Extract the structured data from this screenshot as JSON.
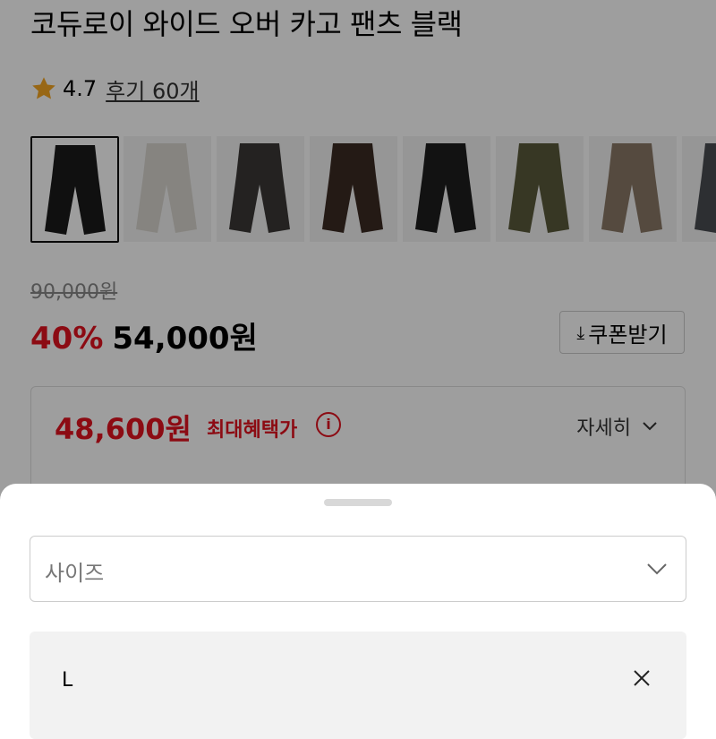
{
  "product": {
    "title": "코듀로이 와이드 오버 카고 팬츠 블랙",
    "rating": "4.7",
    "reviews": "후기 60개",
    "thumbnails": [
      {
        "name": "black",
        "color": "#1b1b1b"
      },
      {
        "name": "ivory",
        "color": "#d9d6cf"
      },
      {
        "name": "charcoal",
        "color": "#3a3836"
      },
      {
        "name": "brown",
        "color": "#3b2a22"
      },
      {
        "name": "black-2",
        "color": "#1e1e1e"
      },
      {
        "name": "khaki",
        "color": "#5a5a3a"
      },
      {
        "name": "beige",
        "color": "#8a7866"
      },
      {
        "name": "gray",
        "color": "#4a4d52"
      }
    ]
  },
  "price": {
    "original": "90,000원",
    "discount": "40%",
    "sale": "54,000원",
    "coupon_label": "쿠폰받기"
  },
  "benefit": {
    "price": "48,600원",
    "label": "최대혜택가",
    "detail": "자세히"
  },
  "sheet": {
    "select_placeholder": "사이즈",
    "selected_size": "L"
  },
  "colors": {
    "accent": "#e3121f",
    "star": "#f5a623"
  }
}
